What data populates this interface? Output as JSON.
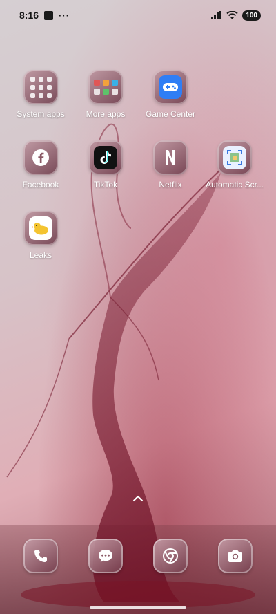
{
  "status_bar": {
    "time": "8:16",
    "battery": "100"
  },
  "apps": [
    {
      "label": "System apps",
      "icon": "folder-icon"
    },
    {
      "label": "More apps",
      "icon": "folder-icon"
    },
    {
      "label": "Game Center",
      "icon": "game-controller-icon"
    },
    {
      "label": "Facebook",
      "icon": "facebook-icon"
    },
    {
      "label": "TikTok",
      "icon": "tiktok-icon"
    },
    {
      "label": "Netflix",
      "icon": "netflix-icon"
    },
    {
      "label": "Automatic Scr...",
      "icon": "automatic-screenshot-icon"
    },
    {
      "label": "Leaks",
      "icon": "duck-icon"
    }
  ],
  "dock": [
    {
      "icon": "phone-icon"
    },
    {
      "icon": "messages-icon"
    },
    {
      "icon": "chrome-icon"
    },
    {
      "icon": "camera-icon"
    }
  ],
  "colors": {
    "game_center": "#2f7ef5",
    "tiktok": "#111111",
    "automatic_screenshot": "#e9f1ff"
  }
}
